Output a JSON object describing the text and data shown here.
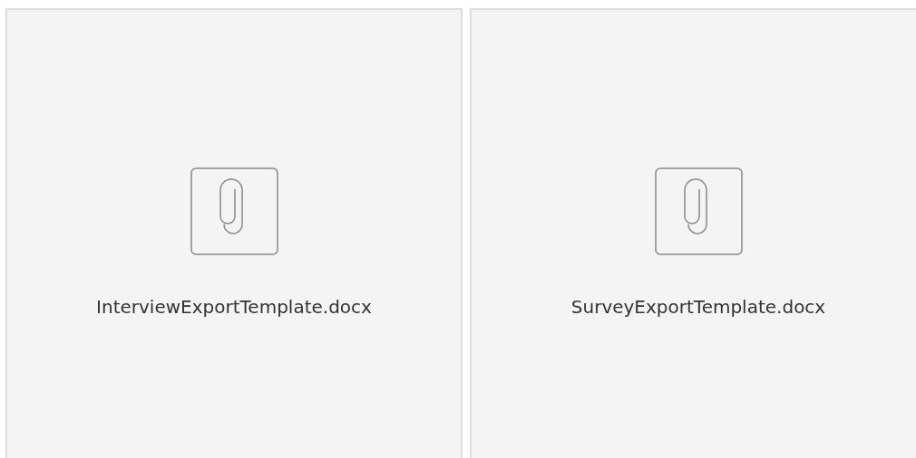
{
  "attachments": [
    {
      "file_name": "InterviewExportTemplate.docx"
    },
    {
      "file_name": "SurveyExportTemplate.docx"
    }
  ]
}
